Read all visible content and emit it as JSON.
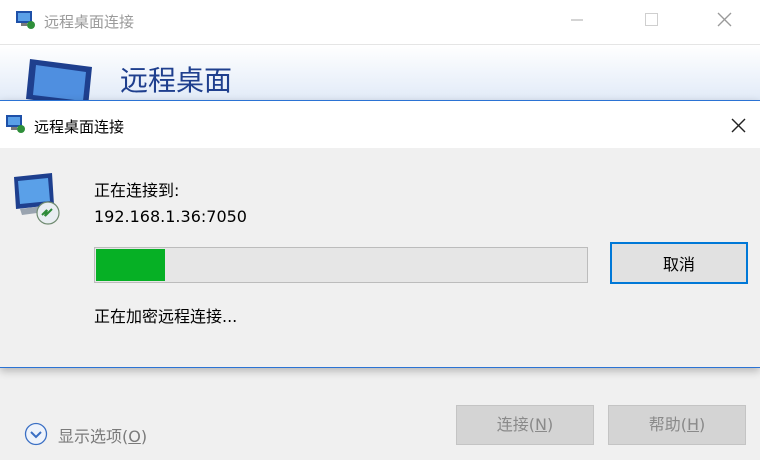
{
  "main_window": {
    "title": "远程桌面连接",
    "banner_title": "远程桌面",
    "options_label": "显示选项(",
    "options_key": "O",
    "connect_label": "连接(",
    "connect_key": "N",
    "help_label": "帮助(",
    "help_key": "H",
    "close_paren": ")"
  },
  "dialog": {
    "title": "远程桌面连接",
    "connecting_label": "正在连接到:",
    "address": "192.168.1.36:7050",
    "progress_percent": 14,
    "cancel_label": "取消",
    "status_text": "正在加密远程连接..."
  },
  "colors": {
    "accent": "#0078d7",
    "progress_fill": "#06b025",
    "banner_title": "#1f3f8e"
  },
  "icons": [
    "remote-desktop-icon",
    "minimize-icon",
    "maximize-icon",
    "close-icon",
    "chevron-down-icon"
  ]
}
